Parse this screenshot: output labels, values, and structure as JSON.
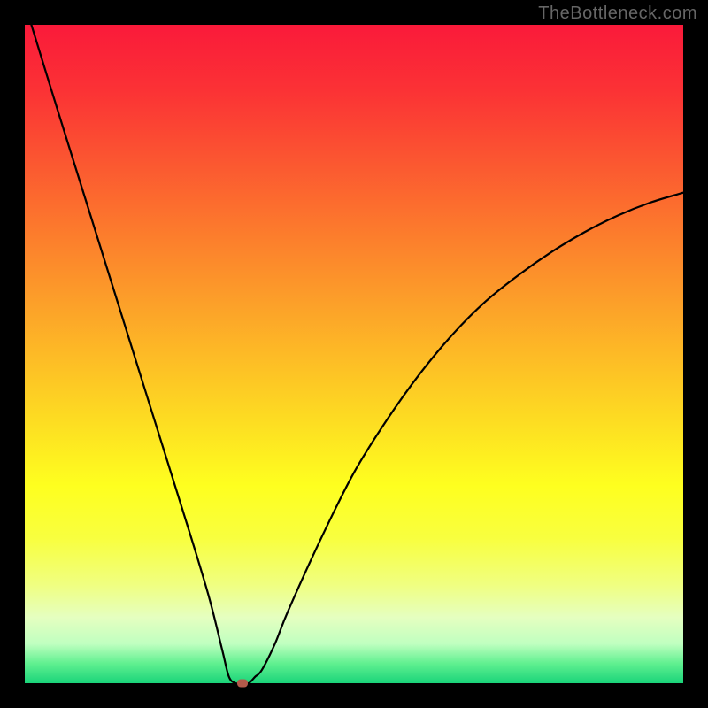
{
  "watermark": "TheBottleneck.com",
  "chart_data": {
    "type": "line",
    "title": "",
    "xlabel": "",
    "ylabel": "",
    "xlim": [
      0,
      100
    ],
    "ylim": [
      0,
      100
    ],
    "grid": false,
    "legend": false,
    "series": [
      {
        "name": "bottleneck-curve",
        "x": [
          1,
          5,
          10,
          15,
          20,
          25,
          28,
          30,
          31,
          32,
          33,
          34,
          35,
          36,
          38,
          40,
          45,
          50,
          55,
          60,
          65,
          70,
          75,
          80,
          85,
          90,
          95,
          100
        ],
        "y": [
          100,
          87,
          71,
          55,
          39,
          23,
          13,
          5,
          1,
          0,
          0,
          0,
          1,
          2,
          6,
          11,
          22,
          32,
          40,
          47,
          53,
          58,
          62,
          65.5,
          68.5,
          71,
          73,
          74.5
        ]
      }
    ],
    "marker": {
      "x": 33,
      "y": 0
    },
    "background_gradient": {
      "stops": [
        {
          "offset": 0.0,
          "color": "#fa1a3a"
        },
        {
          "offset": 0.1,
          "color": "#fb3235"
        },
        {
          "offset": 0.2,
          "color": "#fb5431"
        },
        {
          "offset": 0.3,
          "color": "#fc762d"
        },
        {
          "offset": 0.4,
          "color": "#fc982a"
        },
        {
          "offset": 0.5,
          "color": "#fdba26"
        },
        {
          "offset": 0.6,
          "color": "#fddc22"
        },
        {
          "offset": 0.7,
          "color": "#feff1f"
        },
        {
          "offset": 0.78,
          "color": "#f8ff3f"
        },
        {
          "offset": 0.85,
          "color": "#f0ff80"
        },
        {
          "offset": 0.9,
          "color": "#e5ffc0"
        },
        {
          "offset": 0.94,
          "color": "#c0ffc0"
        },
        {
          "offset": 0.97,
          "color": "#60f090"
        },
        {
          "offset": 1.0,
          "color": "#1ad47a"
        }
      ]
    }
  }
}
